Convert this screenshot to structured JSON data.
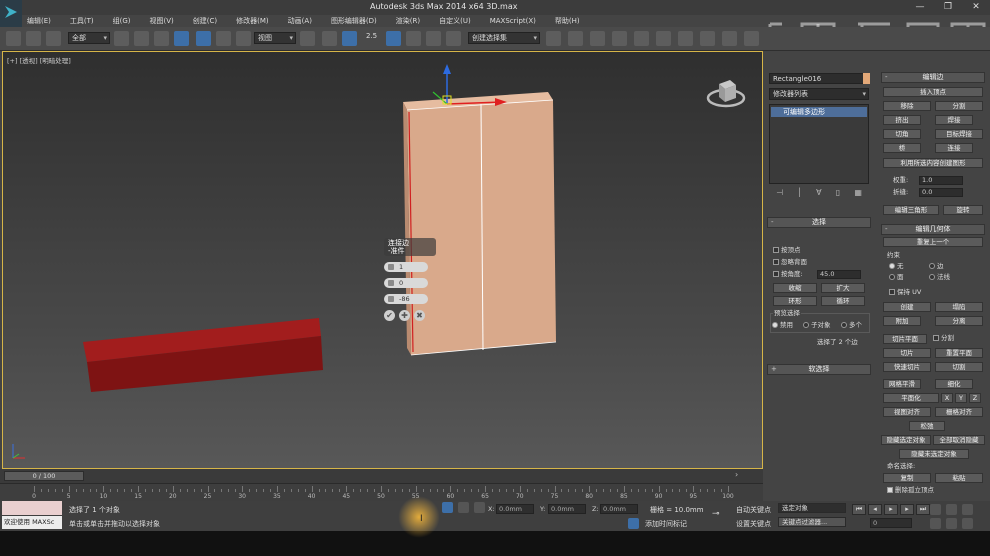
{
  "window": {
    "title": "Autodesk 3ds Max  2014 x64      3D.max",
    "controls": [
      "—",
      "❐",
      "✕"
    ]
  },
  "menu": [
    "编辑(E)",
    "工具(T)",
    "组(G)",
    "视图(V)",
    "创建(C)",
    "修改器(M)",
    "动画(A)",
    "图形编辑器(D)",
    "渲染(R)",
    "自定义(U)",
    "MAXScript(X)",
    "帮助(H)"
  ],
  "toolbar": {
    "filter": "全部",
    "ref_coord": "视图",
    "snap_value": "2.5",
    "selection_set": "创建选择集"
  },
  "viewport": {
    "label": "[+] [透视] [明暗处理]",
    "caddy": {
      "title_line1": "连接边",
      "title_line2": "-准件",
      "field1": "1",
      "field2": "0",
      "field3": "-86",
      "ok": "✔",
      "apply": "✚",
      "cancel": "✖"
    }
  },
  "command_panel": {
    "object_name": "Rectangle016",
    "modifier_list": "修改器列表",
    "stack_item": "可编辑多边形",
    "selection_rollout": {
      "title": "选择",
      "by_vertex": "按顶点",
      "ignore_back": "忽略背面",
      "by_angle": "按角度:",
      "angle_value": "45.0",
      "shrink": "收缩",
      "grow": "扩大",
      "ring": "环形",
      "loop": "循环",
      "preview_title": "预览选择",
      "disabled": "禁用",
      "sub_object": "子对象",
      "multi": "多个",
      "status": "选择了 2 个边"
    },
    "soft_selection": "软选择",
    "edit_edges": {
      "title": "编辑边",
      "insert_vertex": "插入顶点",
      "remove": "移除",
      "split": "分割",
      "extrude": "挤出",
      "weld": "焊接",
      "chamfer": "切角",
      "target_weld": "目标焊接",
      "bridge": "桥",
      "connect": "连接",
      "create_shape": "利用所选内容创建图形",
      "weight_label": "权重:",
      "weight_value": "1.0",
      "crease_label": "折缝:",
      "crease_value": "0.0",
      "edit_tri": "编辑三角形",
      "turn": "旋转"
    },
    "edit_geometry": {
      "title": "编辑几何体",
      "repeat_last": "重复上一个",
      "constraints": "约束",
      "none": "无",
      "edge": "边",
      "face": "面",
      "normal": "法线",
      "preserve_uv": "保持 UV",
      "create": "创建",
      "collapse": "塌陷",
      "attach": "附加",
      "detach": "分离",
      "slice_plane": "切片平面",
      "split": "分割",
      "slice": "切片",
      "reset_plane": "重置平面",
      "quickslice": "快速切片",
      "cut": "切割",
      "meshsmooth": "网格平滑",
      "tessellate": "细化",
      "make_planar": "平面化",
      "x": "X",
      "y": "Y",
      "z": "Z",
      "view_align": "视图对齐",
      "grid_align": "栅格对齐",
      "relax": "松弛",
      "hide_selected": "隐藏选定对象",
      "unhide_all": "全部取消隐藏",
      "hide_unselected": "隐藏未选定对象",
      "named_sel": "命名选择:",
      "copy": "复制",
      "paste": "粘贴",
      "delete_iso": "删除孤立顶点"
    }
  },
  "timeline": {
    "frame": "0 / 100",
    "ticks": [
      "0",
      "5",
      "10",
      "15",
      "20",
      "25",
      "30",
      "35",
      "40",
      "45",
      "50",
      "55",
      "60",
      "65",
      "70",
      "75",
      "80",
      "85",
      "90",
      "95",
      "100"
    ]
  },
  "status": {
    "maxscript": "欢迎使用 MAXSc",
    "selected": "选择了 1 个对象",
    "prompt": "单击或单击并拖动以选择对象",
    "x_label": "X:",
    "x_value": "0.0mm",
    "y_label": "Y:",
    "y_value": "0.0mm",
    "z_label": "Z:",
    "z_value": "0.0mm",
    "grid": "栅格 = 10.0mm",
    "autokey": "自动关键点",
    "selected_obj": "选定对象",
    "set_key": "设置关键点",
    "key_filters": "关键点过滤器...",
    "add_time_tag": "添加时间标记",
    "frame_value": "0"
  },
  "colors": {
    "accent": "#d6b548",
    "selected_box": "#d9a98b",
    "red_box": "#8e1818"
  }
}
